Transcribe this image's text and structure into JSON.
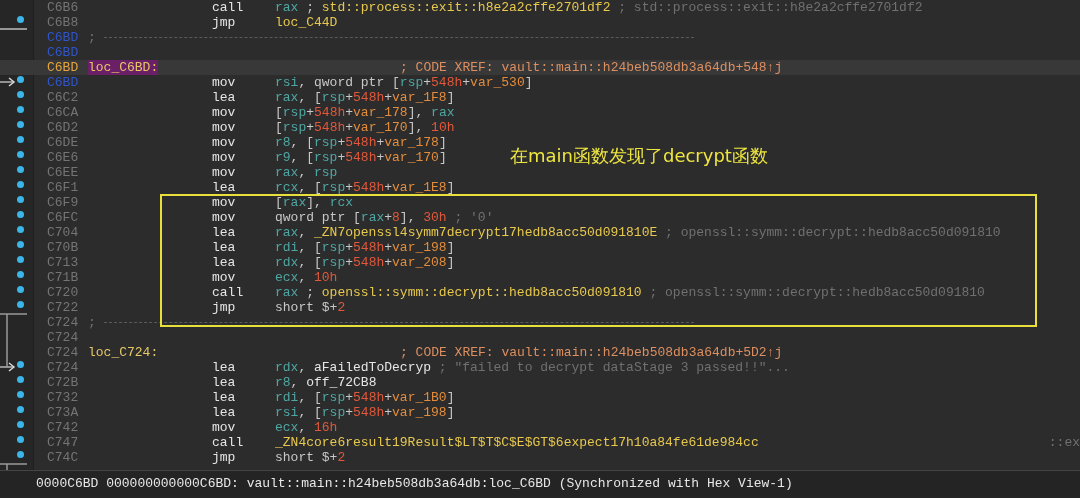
{
  "rows": [
    {
      "kind": "instr",
      "address": {
        "kind": "plain",
        "text": "C6B6"
      },
      "mnemonic": "call",
      "operand": [
        {
          "kind": "reg",
          "text": "rax"
        },
        {
          "kind": "punct",
          "text": " ; "
        },
        {
          "kind": "sym",
          "text": "std::process::exit::h8e2a2cffe2701df2"
        }
      ],
      "comment": "; std::process::exit::h8e2a2cffe2701df2"
    },
    {
      "kind": "instr",
      "address": {
        "kind": "plain",
        "text": "C6B8"
      },
      "dot": true,
      "jump": {
        "kind": "out_up"
      },
      "mnemonic": "jmp",
      "operand": [
        {
          "kind": "sym",
          "text": "loc_C44D"
        }
      ]
    },
    {
      "kind": "separator",
      "address": {
        "kind": "marker",
        "text": "C6BD"
      },
      "text": ";"
    },
    {
      "kind": "blank",
      "address": {
        "kind": "marker",
        "text": "C6BD"
      }
    },
    {
      "kind": "label",
      "address": {
        "kind": "current",
        "text": "C6BD"
      },
      "current": true,
      "label": "loc_C6BD:",
      "comment": "; CODE XREF: vault::main::h24beb508db3a64db+548↑j"
    },
    {
      "kind": "instr",
      "address": {
        "kind": "marker",
        "text": "C6BD"
      },
      "dot": true,
      "jump": {
        "kind": "in"
      },
      "mnemonic": "mov",
      "operand": [
        {
          "kind": "reg",
          "text": "rsi"
        },
        {
          "kind": "punct",
          "text": ", qword ptr ["
        },
        {
          "kind": "reg",
          "text": "rsp"
        },
        {
          "kind": "punct",
          "text": "+"
        },
        {
          "kind": "num",
          "text": "548h"
        },
        {
          "kind": "punct",
          "text": "+"
        },
        {
          "kind": "var",
          "text": "var_530"
        },
        {
          "kind": "punct",
          "text": "]"
        }
      ]
    },
    {
      "kind": "instr",
      "address": {
        "kind": "plain",
        "text": "C6C2"
      },
      "dot": true,
      "mnemonic": "lea",
      "operand": [
        {
          "kind": "reg",
          "text": "rax"
        },
        {
          "kind": "punct",
          "text": ", ["
        },
        {
          "kind": "reg",
          "text": "rsp"
        },
        {
          "kind": "punct",
          "text": "+"
        },
        {
          "kind": "num",
          "text": "548h"
        },
        {
          "kind": "punct",
          "text": "+"
        },
        {
          "kind": "var",
          "text": "var_1F8"
        },
        {
          "kind": "punct",
          "text": "]"
        }
      ]
    },
    {
      "kind": "instr",
      "address": {
        "kind": "plain",
        "text": "C6CA"
      },
      "dot": true,
      "mnemonic": "mov",
      "operand": [
        {
          "kind": "punct",
          "text": "["
        },
        {
          "kind": "reg",
          "text": "rsp"
        },
        {
          "kind": "punct",
          "text": "+"
        },
        {
          "kind": "num",
          "text": "548h"
        },
        {
          "kind": "punct",
          "text": "+"
        },
        {
          "kind": "var",
          "text": "var_178"
        },
        {
          "kind": "punct",
          "text": "], "
        },
        {
          "kind": "reg",
          "text": "rax"
        }
      ]
    },
    {
      "kind": "instr",
      "address": {
        "kind": "plain",
        "text": "C6D2"
      },
      "dot": true,
      "mnemonic": "mov",
      "operand": [
        {
          "kind": "punct",
          "text": "["
        },
        {
          "kind": "reg",
          "text": "rsp"
        },
        {
          "kind": "punct",
          "text": "+"
        },
        {
          "kind": "num",
          "text": "548h"
        },
        {
          "kind": "punct",
          "text": "+"
        },
        {
          "kind": "var",
          "text": "var_170"
        },
        {
          "kind": "punct",
          "text": "], "
        },
        {
          "kind": "num",
          "text": "10h"
        }
      ]
    },
    {
      "kind": "instr",
      "address": {
        "kind": "plain",
        "text": "C6DE"
      },
      "dot": true,
      "mnemonic": "mov",
      "operand": [
        {
          "kind": "reg",
          "text": "r8"
        },
        {
          "kind": "punct",
          "text": ", ["
        },
        {
          "kind": "reg",
          "text": "rsp"
        },
        {
          "kind": "punct",
          "text": "+"
        },
        {
          "kind": "num",
          "text": "548h"
        },
        {
          "kind": "punct",
          "text": "+"
        },
        {
          "kind": "var",
          "text": "var_178"
        },
        {
          "kind": "punct",
          "text": "]"
        }
      ]
    },
    {
      "kind": "instr",
      "address": {
        "kind": "plain",
        "text": "C6E6"
      },
      "dot": true,
      "mnemonic": "mov",
      "operand": [
        {
          "kind": "reg",
          "text": "r9"
        },
        {
          "kind": "punct",
          "text": ", ["
        },
        {
          "kind": "reg",
          "text": "rsp"
        },
        {
          "kind": "punct",
          "text": "+"
        },
        {
          "kind": "num",
          "text": "548h"
        },
        {
          "kind": "punct",
          "text": "+"
        },
        {
          "kind": "var",
          "text": "var_170"
        },
        {
          "kind": "punct",
          "text": "]"
        }
      ],
      "note": "在main函数发现了decrypt函数"
    },
    {
      "kind": "instr",
      "address": {
        "kind": "plain",
        "text": "C6EE"
      },
      "dot": true,
      "mnemonic": "mov",
      "operand": [
        {
          "kind": "reg",
          "text": "rax"
        },
        {
          "kind": "punct",
          "text": ", "
        },
        {
          "kind": "reg",
          "text": "rsp"
        }
      ]
    },
    {
      "kind": "instr",
      "address": {
        "kind": "plain",
        "text": "C6F1"
      },
      "dot": true,
      "mnemonic": "lea",
      "operand": [
        {
          "kind": "reg",
          "text": "rcx"
        },
        {
          "kind": "punct",
          "text": ", ["
        },
        {
          "kind": "reg",
          "text": "rsp"
        },
        {
          "kind": "punct",
          "text": "+"
        },
        {
          "kind": "num",
          "text": "548h"
        },
        {
          "kind": "punct",
          "text": "+"
        },
        {
          "kind": "var",
          "text": "var_1E8"
        },
        {
          "kind": "punct",
          "text": "]"
        }
      ]
    },
    {
      "kind": "instr",
      "address": {
        "kind": "plain",
        "text": "C6F9"
      },
      "dot": true,
      "boxed": true,
      "mnemonic": "mov",
      "operand": [
        {
          "kind": "punct",
          "text": "["
        },
        {
          "kind": "reg",
          "text": "rax"
        },
        {
          "kind": "punct",
          "text": "], "
        },
        {
          "kind": "reg",
          "text": "rcx"
        }
      ]
    },
    {
      "kind": "instr",
      "address": {
        "kind": "plain",
        "text": "C6FC"
      },
      "dot": true,
      "boxed": true,
      "mnemonic": "mov",
      "operand": [
        {
          "kind": "punct",
          "text": "qword ptr ["
        },
        {
          "kind": "reg",
          "text": "rax"
        },
        {
          "kind": "punct",
          "text": "+"
        },
        {
          "kind": "num",
          "text": "8"
        },
        {
          "kind": "punct",
          "text": "], "
        },
        {
          "kind": "num",
          "text": "30h"
        }
      ],
      "comment": "; '0'"
    },
    {
      "kind": "instr",
      "address": {
        "kind": "plain",
        "text": "C704"
      },
      "dot": true,
      "boxed": true,
      "mnemonic": "lea",
      "operand": [
        {
          "kind": "reg",
          "text": "rax"
        },
        {
          "kind": "punct",
          "text": ", "
        },
        {
          "kind": "sym",
          "text": "_ZN7openssl4symm7decrypt17hedb8acc50d091810E"
        }
      ],
      "comment": "; openssl::symm::decrypt::hedb8acc50d091810"
    },
    {
      "kind": "instr",
      "address": {
        "kind": "plain",
        "text": "C70B"
      },
      "dot": true,
      "boxed": true,
      "mnemonic": "lea",
      "operand": [
        {
          "kind": "reg",
          "text": "rdi"
        },
        {
          "kind": "punct",
          "text": ", ["
        },
        {
          "kind": "reg",
          "text": "rsp"
        },
        {
          "kind": "punct",
          "text": "+"
        },
        {
          "kind": "num",
          "text": "548h"
        },
        {
          "kind": "punct",
          "text": "+"
        },
        {
          "kind": "var",
          "text": "var_198"
        },
        {
          "kind": "punct",
          "text": "]"
        }
      ]
    },
    {
      "kind": "instr",
      "address": {
        "kind": "plain",
        "text": "C713"
      },
      "dot": true,
      "boxed": true,
      "mnemonic": "lea",
      "operand": [
        {
          "kind": "reg",
          "text": "rdx"
        },
        {
          "kind": "punct",
          "text": ", ["
        },
        {
          "kind": "reg",
          "text": "rsp"
        },
        {
          "kind": "punct",
          "text": "+"
        },
        {
          "kind": "num",
          "text": "548h"
        },
        {
          "kind": "punct",
          "text": "+"
        },
        {
          "kind": "var",
          "text": "var_208"
        },
        {
          "kind": "punct",
          "text": "]"
        }
      ]
    },
    {
      "kind": "instr",
      "address": {
        "kind": "plain",
        "text": "C71B"
      },
      "dot": true,
      "boxed": true,
      "mnemonic": "mov",
      "operand": [
        {
          "kind": "reg",
          "text": "ecx"
        },
        {
          "kind": "punct",
          "text": ", "
        },
        {
          "kind": "num",
          "text": "10h"
        }
      ]
    },
    {
      "kind": "instr",
      "address": {
        "kind": "plain",
        "text": "C720"
      },
      "dot": true,
      "boxed": true,
      "mnemonic": "call",
      "operand": [
        {
          "kind": "reg",
          "text": "rax"
        },
        {
          "kind": "punct",
          "text": " ; "
        },
        {
          "kind": "sym",
          "text": "openssl::symm::decrypt::hedb8acc50d091810"
        }
      ],
      "comment": "; openssl::symm::decrypt::hedb8acc50d091810"
    },
    {
      "kind": "instr",
      "address": {
        "kind": "plain",
        "text": "C722"
      },
      "dot": true,
      "boxed": true,
      "jump": {
        "kind": "out_down"
      },
      "mnemonic": "jmp",
      "operand": [
        {
          "kind": "punct",
          "text": "short $+"
        },
        {
          "kind": "num",
          "text": "2"
        }
      ]
    },
    {
      "kind": "separator",
      "address": {
        "kind": "plain",
        "text": "C724"
      },
      "text": ";"
    },
    {
      "kind": "blank",
      "address": {
        "kind": "plain",
        "text": "C724"
      }
    },
    {
      "kind": "label",
      "address": {
        "kind": "plain",
        "text": "C724"
      },
      "current": false,
      "label": "loc_C724:",
      "comment": "; CODE XREF: vault::main::h24beb508db3a64db+5D2↑j"
    },
    {
      "kind": "instr",
      "address": {
        "kind": "plain",
        "text": "C724"
      },
      "dot": true,
      "jump": {
        "kind": "in"
      },
      "mnemonic": "lea",
      "operand": [
        {
          "kind": "reg",
          "text": "rdx"
        },
        {
          "kind": "punct",
          "text": ", "
        },
        {
          "kind": "ident",
          "text": "aFailedToDecryp"
        }
      ],
      "comment": "; \"failed to decrypt dataStage 3 passed!!\"..."
    },
    {
      "kind": "instr",
      "address": {
        "kind": "plain",
        "text": "C72B"
      },
      "dot": true,
      "mnemonic": "lea",
      "operand": [
        {
          "kind": "reg",
          "text": "r8"
        },
        {
          "kind": "punct",
          "text": ", "
        },
        {
          "kind": "ident",
          "text": "off_72CB8"
        }
      ]
    },
    {
      "kind": "instr",
      "address": {
        "kind": "plain",
        "text": "C732"
      },
      "dot": true,
      "mnemonic": "lea",
      "operand": [
        {
          "kind": "reg",
          "text": "rdi"
        },
        {
          "kind": "punct",
          "text": ", ["
        },
        {
          "kind": "reg",
          "text": "rsp"
        },
        {
          "kind": "punct",
          "text": "+"
        },
        {
          "kind": "num",
          "text": "548h"
        },
        {
          "kind": "punct",
          "text": "+"
        },
        {
          "kind": "var",
          "text": "var_1B0"
        },
        {
          "kind": "punct",
          "text": "]"
        }
      ]
    },
    {
      "kind": "instr",
      "address": {
        "kind": "plain",
        "text": "C73A"
      },
      "dot": true,
      "mnemonic": "lea",
      "operand": [
        {
          "kind": "reg",
          "text": "rsi"
        },
        {
          "kind": "punct",
          "text": ", ["
        },
        {
          "kind": "reg",
          "text": "rsp"
        },
        {
          "kind": "punct",
          "text": "+"
        },
        {
          "kind": "num",
          "text": "548h"
        },
        {
          "kind": "punct",
          "text": "+"
        },
        {
          "kind": "var",
          "text": "var_198"
        },
        {
          "kind": "punct",
          "text": "]"
        }
      ]
    },
    {
      "kind": "instr",
      "address": {
        "kind": "plain",
        "text": "C742"
      },
      "dot": true,
      "mnemonic": "mov",
      "operand": [
        {
          "kind": "reg",
          "text": "ecx"
        },
        {
          "kind": "punct",
          "text": ", "
        },
        {
          "kind": "num",
          "text": "16h"
        }
      ]
    },
    {
      "kind": "instr",
      "address": {
        "kind": "plain",
        "text": "C747"
      },
      "dot": true,
      "mnemonic": "call",
      "operand": [
        {
          "kind": "sym",
          "text": "_ZN4core6result19Result$LT$T$C$E$GT$6expect17h10a84fe61de984cc"
        }
      ],
      "comment": "::ex",
      "comment_far": true
    },
    {
      "kind": "instr",
      "address": {
        "kind": "plain",
        "text": "C74C"
      },
      "dot": true,
      "jump": {
        "kind": "out_down"
      },
      "mnemonic": "jmp",
      "operand": [
        {
          "kind": "punct",
          "text": "short $+"
        },
        {
          "kind": "num",
          "text": "2"
        }
      ]
    }
  ],
  "status_bar": "0000C6BD 000000000000C6BD: vault::main::h24beb508db3a64db:loc_C6BD (Synchronized with Hex View-1)"
}
